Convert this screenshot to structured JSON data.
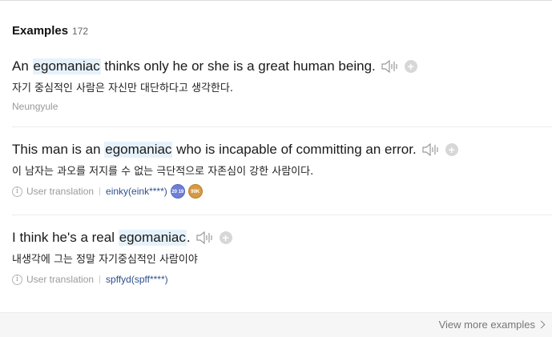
{
  "section": {
    "title": "Examples",
    "count": "172"
  },
  "examples": [
    {
      "en_parts": [
        "An ",
        "egomaniac",
        " thinks only he or she is a great human being."
      ],
      "ko": "자기 중심적인 사람은 자신만 대단하다고 생각한다.",
      "source": "Neungyule"
    },
    {
      "en_parts": [
        "This man is an ",
        "egomaniac",
        " who is incapable of committing an error."
      ],
      "ko": "이 남자는 과오를 저지를 수 없는 극단적으로 자존심이 강한 사람이다.",
      "meta_label": "User translation",
      "user": "einky(eink****)",
      "badges": [
        "20 19",
        "99K"
      ]
    },
    {
      "en_parts": [
        "I think he's a real ",
        "egomaniac",
        "."
      ],
      "ko": "내생각에 그는 정말 자기중심적인 사람이야",
      "meta_label": "User translation",
      "user": "spffyd(spff****)"
    }
  ],
  "footer": {
    "more_label": "View more examples"
  },
  "icons": {
    "speaker": "speaker-icon",
    "add": "plus-icon",
    "info": "info-icon",
    "chevron": "chevron-right-icon"
  },
  "colors": {
    "highlight": "#e6f2fb",
    "user_link": "#2f4f8f",
    "badge_purple": "#6e7fd6",
    "badge_gold": "#d89a3f"
  }
}
